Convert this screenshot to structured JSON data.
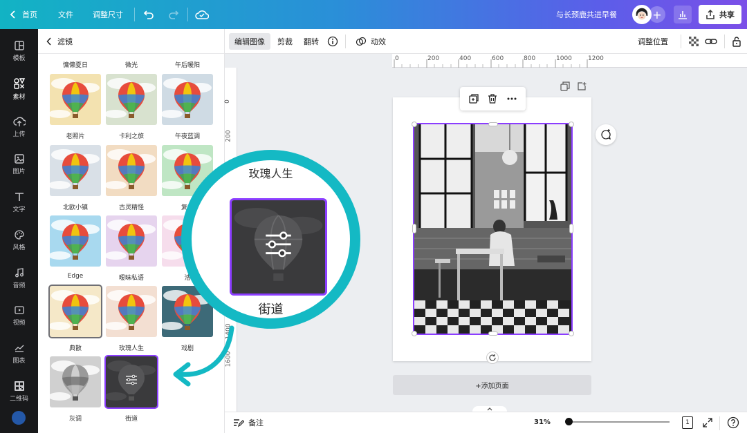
{
  "topbar": {
    "home": "首页",
    "file": "文件",
    "resize": "调整尺寸",
    "doc_title": "与长颈鹿共进早餐",
    "share": "共享"
  },
  "leftnav": {
    "items": [
      {
        "label": "模板",
        "icon": "template-icon"
      },
      {
        "label": "素材",
        "icon": "elements-icon"
      },
      {
        "label": "上传",
        "icon": "upload-icon"
      },
      {
        "label": "图片",
        "icon": "image-icon"
      },
      {
        "label": "文字",
        "icon": "text-icon"
      },
      {
        "label": "风格",
        "icon": "palette-icon"
      },
      {
        "label": "音频",
        "icon": "music-icon"
      },
      {
        "label": "视频",
        "icon": "video-icon"
      },
      {
        "label": "图表",
        "icon": "chart-icon"
      },
      {
        "label": "二维码",
        "icon": "qrcode-icon"
      }
    ]
  },
  "panel": {
    "title": "滤镜",
    "top_labels": [
      "慵懒夏日",
      "微光",
      "午后暖阳"
    ],
    "filters": [
      {
        "label": "老照片",
        "tint": "#f3e2b0"
      },
      {
        "label": "卡利之旅",
        "tint": "#d8e2cf"
      },
      {
        "label": "午夜蓝调",
        "tint": "#cfdbe4"
      },
      {
        "label": "北欧小镇",
        "tint": "#d9e0e7"
      },
      {
        "label": "古灵精怪",
        "tint": "#f2dcc2"
      },
      {
        "label": "复古",
        "tint": "#bfe6c4"
      },
      {
        "label": "Edge",
        "tint": "#a8d9ef"
      },
      {
        "label": "暧昧私语",
        "tint": "#e6d4ee"
      },
      {
        "label": "浩",
        "tint": "#f6ddec"
      },
      {
        "label": "典散",
        "tint": "#f5e8c8"
      },
      {
        "label": "玫瑰人生",
        "tint": "#f3dfd2"
      },
      {
        "label": "戏剧",
        "tint": "#3d6a78"
      },
      {
        "label": "灰调",
        "tint": "#d0d0d0"
      },
      {
        "label": "街道",
        "tint": "#3a3a3c"
      }
    ]
  },
  "editor_toolbar": {
    "edit_image": "编辑图像",
    "crop": "剪裁",
    "flip": "翻转",
    "animate": "动效",
    "position": "调整位置"
  },
  "ruler": {
    "top_ticks": [
      "0",
      "200",
      "400",
      "600",
      "800",
      "1000",
      "1200"
    ],
    "left_ticks": [
      "0",
      "200",
      "1400",
      "1600"
    ]
  },
  "canvas": {
    "add_page": "+添加页面"
  },
  "bottombar": {
    "notes": "备注",
    "zoom": "31%",
    "page_number": "1",
    "zoom_fraction": 0.31
  },
  "magnifier": {
    "top_label": "玫瑰人生",
    "label": "街道"
  },
  "colors": {
    "accent": "#8b3dff",
    "magnifier_ring": "#14b9c4",
    "nav_bg": "#18191b"
  }
}
